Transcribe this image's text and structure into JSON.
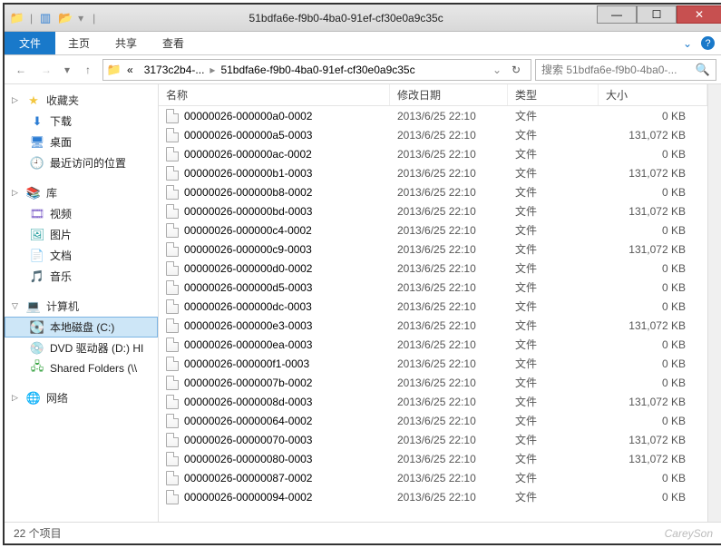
{
  "titlebar": {
    "title": "51bdfa6e-f9b0-4ba0-91ef-cf30e0a9c35c"
  },
  "ribbon": {
    "file": "文件",
    "tabs": [
      "主页",
      "共享",
      "查看"
    ]
  },
  "breadcrumb": {
    "seg1": "3173c2b4-...",
    "seg2": "51bdfa6e-f9b0-4ba0-91ef-cf30e0a9c35c"
  },
  "search": {
    "placeholder": "搜索 51bdfa6e-f9b0-4ba0-..."
  },
  "sidebar": {
    "fav_head": "收藏夹",
    "fav_items": [
      "下载",
      "桌面",
      "最近访问的位置"
    ],
    "lib_head": "库",
    "lib_items": [
      "视频",
      "图片",
      "文档",
      "音乐"
    ],
    "comp_head": "计算机",
    "comp_items": [
      "本地磁盘 (C:)",
      "DVD 驱动器 (D:) HI",
      "Shared Folders (\\\\"
    ],
    "net_head": "网络"
  },
  "columns": {
    "name": "名称",
    "date": "修改日期",
    "type": "类型",
    "size": "大小"
  },
  "files": [
    {
      "name": "00000026-000000a0-0002",
      "date": "2013/6/25 22:10",
      "type": "文件",
      "size": "0 KB"
    },
    {
      "name": "00000026-000000a5-0003",
      "date": "2013/6/25 22:10",
      "type": "文件",
      "size": "131,072 KB"
    },
    {
      "name": "00000026-000000ac-0002",
      "date": "2013/6/25 22:10",
      "type": "文件",
      "size": "0 KB"
    },
    {
      "name": "00000026-000000b1-0003",
      "date": "2013/6/25 22:10",
      "type": "文件",
      "size": "131,072 KB"
    },
    {
      "name": "00000026-000000b8-0002",
      "date": "2013/6/25 22:10",
      "type": "文件",
      "size": "0 KB"
    },
    {
      "name": "00000026-000000bd-0003",
      "date": "2013/6/25 22:10",
      "type": "文件",
      "size": "131,072 KB"
    },
    {
      "name": "00000026-000000c4-0002",
      "date": "2013/6/25 22:10",
      "type": "文件",
      "size": "0 KB"
    },
    {
      "name": "00000026-000000c9-0003",
      "date": "2013/6/25 22:10",
      "type": "文件",
      "size": "131,072 KB"
    },
    {
      "name": "00000026-000000d0-0002",
      "date": "2013/6/25 22:10",
      "type": "文件",
      "size": "0 KB"
    },
    {
      "name": "00000026-000000d5-0003",
      "date": "2013/6/25 22:10",
      "type": "文件",
      "size": "0 KB"
    },
    {
      "name": "00000026-000000dc-0003",
      "date": "2013/6/25 22:10",
      "type": "文件",
      "size": "0 KB"
    },
    {
      "name": "00000026-000000e3-0003",
      "date": "2013/6/25 22:10",
      "type": "文件",
      "size": "131,072 KB"
    },
    {
      "name": "00000026-000000ea-0003",
      "date": "2013/6/25 22:10",
      "type": "文件",
      "size": "0 KB"
    },
    {
      "name": "00000026-000000f1-0003",
      "date": "2013/6/25 22:10",
      "type": "文件",
      "size": "0 KB"
    },
    {
      "name": "00000026-0000007b-0002",
      "date": "2013/6/25 22:10",
      "type": "文件",
      "size": "0 KB"
    },
    {
      "name": "00000026-0000008d-0003",
      "date": "2013/6/25 22:10",
      "type": "文件",
      "size": "131,072 KB"
    },
    {
      "name": "00000026-00000064-0002",
      "date": "2013/6/25 22:10",
      "type": "文件",
      "size": "0 KB"
    },
    {
      "name": "00000026-00000070-0003",
      "date": "2013/6/25 22:10",
      "type": "文件",
      "size": "131,072 KB"
    },
    {
      "name": "00000026-00000080-0003",
      "date": "2013/6/25 22:10",
      "type": "文件",
      "size": "131,072 KB"
    },
    {
      "name": "00000026-00000087-0002",
      "date": "2013/6/25 22:10",
      "type": "文件",
      "size": "0 KB"
    },
    {
      "name": "00000026-00000094-0002",
      "date": "2013/6/25 22:10",
      "type": "文件",
      "size": "0 KB"
    }
  ],
  "status": {
    "count": "22 个项目",
    "watermark": "CareySon"
  }
}
